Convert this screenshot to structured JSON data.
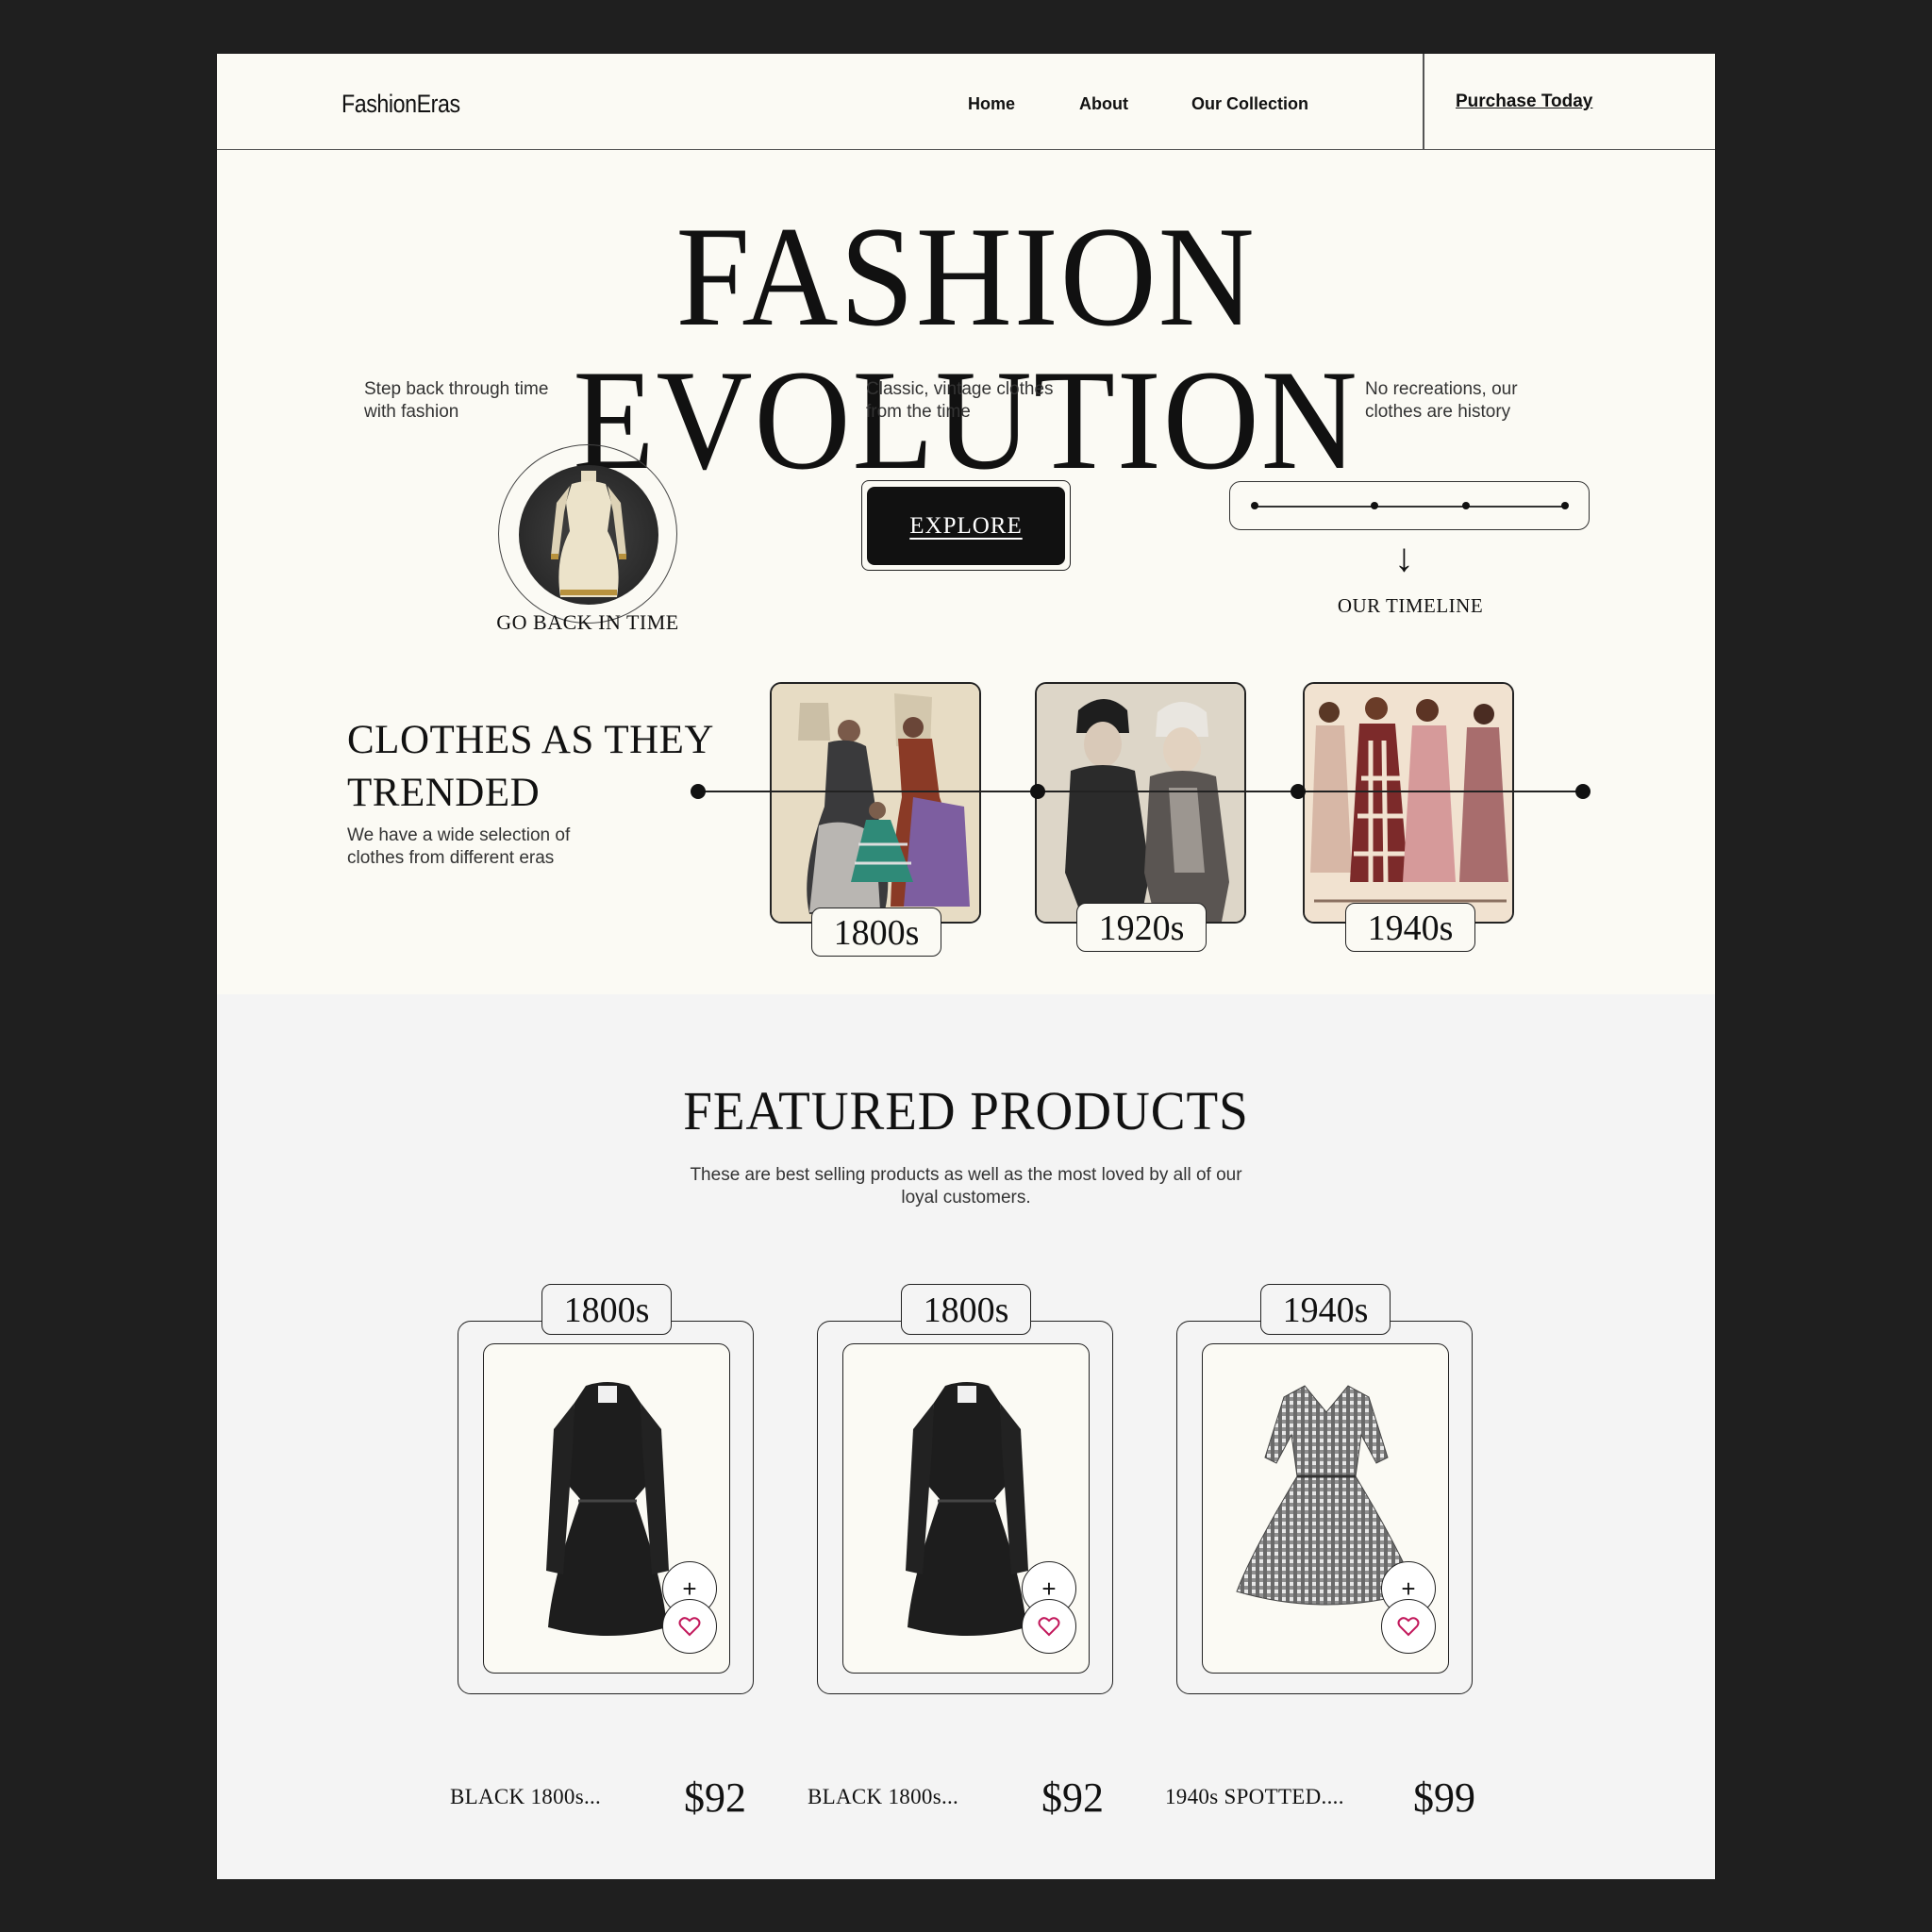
{
  "header": {
    "logo": "FashionEras",
    "nav": [
      "Home",
      "About",
      "Our Collection"
    ],
    "cta": "Purchase Today"
  },
  "hero": {
    "title": "FASHION EVOLUTION",
    "taglines": [
      "Step back through time with fashion",
      "Classic, vintage clothes from the time",
      "No recreations, our clothes are history"
    ],
    "go_back": "GO BACK IN TIME",
    "explore": "EXPLORE",
    "timeline_label": "OUR TIMELINE"
  },
  "trends": {
    "title_line1": "CLOTHES AS THEY",
    "title_line2": "TRENDED",
    "subtitle": "We have a wide selection of clothes from different eras",
    "eras": [
      "1800s",
      "1920s",
      "1940s"
    ]
  },
  "featured": {
    "title": "FEATURED PRODUCTS",
    "subtitle": "These are best selling products as well as the most loved by all of our loyal customers.",
    "products": [
      {
        "era": "1800s",
        "name": "BLACK 1800s...",
        "price": "$92"
      },
      {
        "era": "1800s",
        "name": "BLACK 1800s...",
        "price": "$92"
      },
      {
        "era": "1940s",
        "name": "1940s SPOTTED....",
        "price": "$99"
      }
    ]
  },
  "icons": {
    "arrow": "arrow-down-icon",
    "add": "plus-icon",
    "favorite": "heart-icon"
  },
  "colors": {
    "page_bg": "#fbfaf4",
    "section_bg": "#f4f4f4",
    "outer_bg": "#1f1f1f",
    "heart": "#c2185b"
  }
}
